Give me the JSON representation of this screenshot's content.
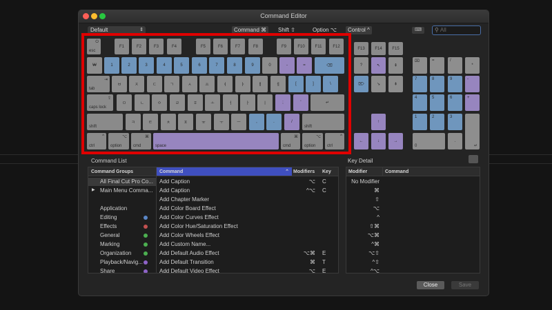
{
  "window": {
    "title": "Command Editor"
  },
  "toolbar": {
    "preset": "Default",
    "modifiers": [
      "Command ⌘",
      "Shift ⇧",
      "Option ⌥",
      "Control ^"
    ],
    "keyboard_button": "⌨",
    "search_placeholder": "All"
  },
  "colors": {
    "blue": "#6f96bd",
    "purple": "#9785bf",
    "gray": "#8a8a8a",
    "highlight": "#3f4fbf",
    "red_box": "#e00000"
  },
  "keys": {
    "esc": "esc",
    "power": "⏻",
    "fn": [
      "F1",
      "F2",
      "F3",
      "F4",
      "F5",
      "F6",
      "F7",
      "F8",
      "F9",
      "F10",
      "F11",
      "F12",
      "F13",
      "F14",
      "F15"
    ],
    "num_row": [
      "₩",
      "1",
      "2",
      "3",
      "4",
      "5",
      "6",
      "7",
      "8",
      "9",
      "0",
      "-",
      "=",
      "⌫"
    ],
    "tab": "tab",
    "tab_arrow": "⇥",
    "qrow": [
      "ㅂ",
      "ㅈ",
      "ㄷ",
      "ㄱ",
      "ㅅ",
      "ㅛ",
      "ㅕ",
      "ㅑ",
      "ㅐ",
      "ㅔ",
      "[",
      "]",
      "\\"
    ],
    "caps": "caps lock",
    "caps_arrow": "⇪",
    "arow": [
      "ㅁ",
      "ㄴ",
      "ㅇ",
      "ㄹ",
      "ㅎ",
      "ㅗ",
      "ㅓ",
      "ㅏ",
      "ㅣ",
      ";",
      "'"
    ],
    "return": "↵",
    "shift": "shift",
    "zrow": [
      "ㅋ",
      "ㅌ",
      "ㅊ",
      "ㅍ",
      "ㅠ",
      "ㅜ",
      "ㅡ",
      ",",
      ".",
      "/"
    ],
    "ctrl": "ctrl",
    "ctrl_sym": "^",
    "option": "option",
    "option_sym": "⌥",
    "cmd": "cmd",
    "cmd_sym": "⌘",
    "space": "space",
    "nav": [
      "?",
      "↖",
      "⇞",
      "⌦",
      "↘",
      "⇟"
    ],
    "arrows": [
      "↑",
      "←",
      "↓",
      "→"
    ],
    "numpad": [
      "⌧",
      "=",
      "/",
      "*",
      "7",
      "8",
      "9",
      "-",
      "4",
      "5",
      "6",
      "+",
      "1",
      "2",
      "3",
      "0",
      ".",
      "↵"
    ]
  },
  "command_list": {
    "section_label": "Command List",
    "groups_header": "Command Groups",
    "groups": [
      {
        "label": "All Final Cut Pro Co...",
        "selected": true
      },
      {
        "label": "Main Menu Comma...",
        "expand": "▶"
      },
      {
        "label": "Application",
        "color": ""
      },
      {
        "label": "Editing",
        "color": "#5a86c6"
      },
      {
        "label": "Effects",
        "color": "#c15050"
      },
      {
        "label": "General",
        "color": "#4caf50"
      },
      {
        "label": "Marking",
        "color": "#4caf50"
      },
      {
        "label": "Organization",
        "color": "#4caf50"
      },
      {
        "label": "Playback/Navig...",
        "color": "#8e63c7"
      },
      {
        "label": "Share",
        "color": "#8e63c7"
      }
    ],
    "columns": {
      "command": "Command",
      "sort": "⌃",
      "modifiers": "Modifiers",
      "key": "Key"
    },
    "commands": [
      {
        "name": "Add Caption",
        "mods": "⌥",
        "key": "C"
      },
      {
        "name": "Add Caption",
        "mods": "^⌥",
        "key": "C"
      },
      {
        "name": "Add Chapter Marker",
        "mods": "",
        "key": ""
      },
      {
        "name": "Add Color Board Effect",
        "mods": "",
        "key": ""
      },
      {
        "name": "Add Color Curves Effect",
        "mods": "",
        "key": ""
      },
      {
        "name": "Add Color Hue/Saturation Effect",
        "mods": "",
        "key": ""
      },
      {
        "name": "Add Color Wheels Effect",
        "mods": "",
        "key": ""
      },
      {
        "name": "Add Custom Name...",
        "mods": "",
        "key": ""
      },
      {
        "name": "Add Default Audio Effect",
        "mods": "⌥⌘",
        "key": "E"
      },
      {
        "name": "Add Default Transition",
        "mods": "⌘",
        "key": "T"
      },
      {
        "name": "Add Default Video Effect",
        "mods": "⌥",
        "key": "E"
      }
    ]
  },
  "key_detail": {
    "section_label": "Key Detail",
    "columns": {
      "modifier": "Modifier",
      "command": "Command"
    },
    "modifiers": [
      "No Modifier",
      "⌘",
      "⇧",
      "⌥",
      "^",
      "⇧⌘",
      "⌥⌘",
      "^⌘",
      "⌥⇧",
      "^⇧",
      "^⌥"
    ]
  },
  "footer": {
    "close": "Close",
    "save": "Save"
  }
}
